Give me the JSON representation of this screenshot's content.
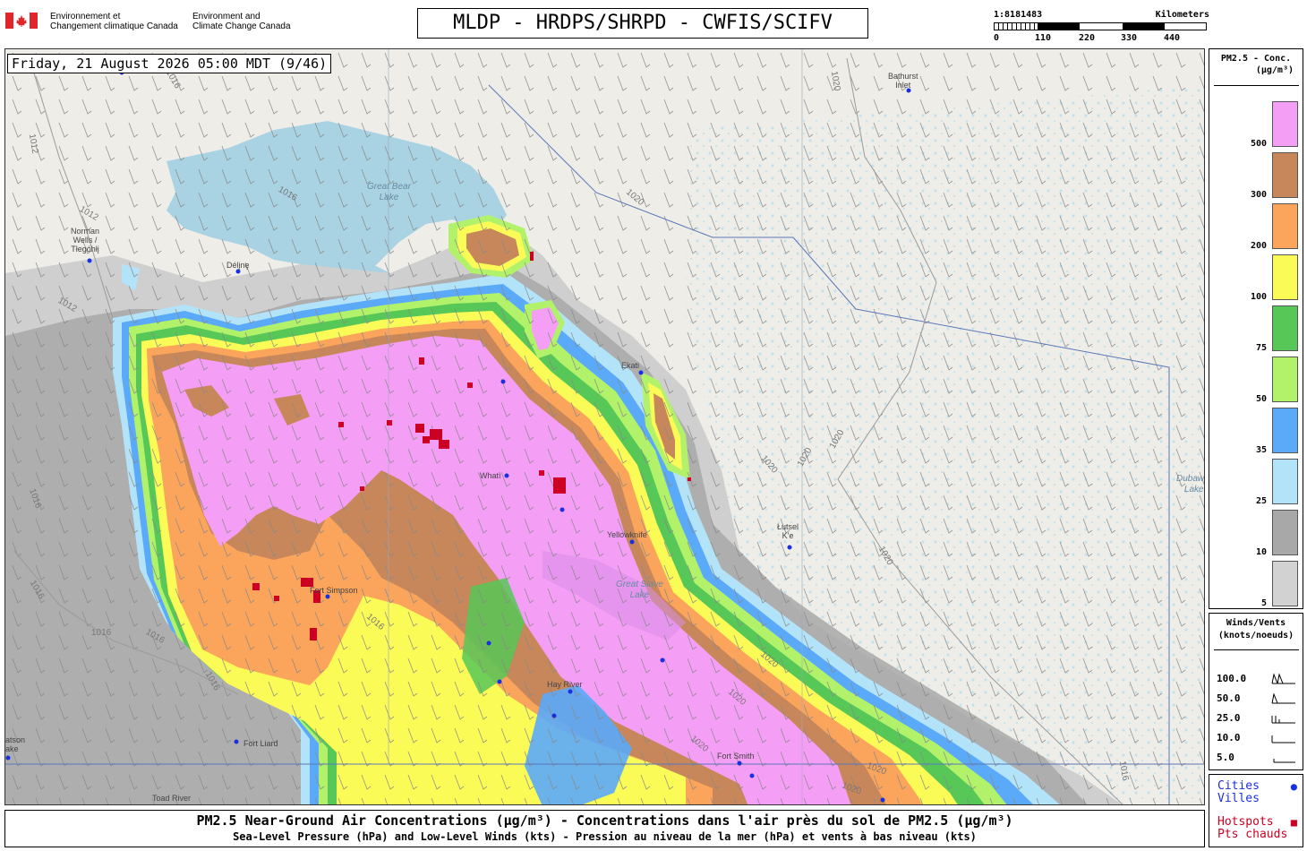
{
  "header": {
    "gov_fr": [
      "Environnement et",
      "Changement climatique Canada"
    ],
    "gov_en": [
      "Environment and",
      "Climate Change Canada"
    ],
    "title": "MLDP - HRDPS/SHRPD - CWFIS/SCIFV",
    "scale_ratio": "1:8181483",
    "scale_unit": "Kilometers",
    "scale_ticks": [
      "0",
      "110",
      "220",
      "330",
      "440"
    ]
  },
  "map": {
    "datestamp": "Friday, 21 August 2026 05:00 MDT (9/46)",
    "places": {
      "norman_wells": [
        "Norman",
        "Wells /",
        "Tłegóhłį"
      ],
      "deline": "Délįnę",
      "whati": "Whatì",
      "yellowknife": "Yellowknife",
      "hay_river": "Hay River",
      "fort_smith": "Fort Smith",
      "fort_liard": "Fort Liard",
      "toad_river": "Toad River",
      "lutsel_ke": [
        "Łutsel",
        "K'e"
      ],
      "bathurst_inlet": [
        "Bathurst",
        "Inlet"
      ],
      "fort_simpson": "Fort Simpson",
      "watson_lake": [
        "atson",
        "ake"
      ],
      "ekati": "Ekati"
    },
    "lakes": {
      "great_bear": [
        "Great Bear",
        "Lake"
      ],
      "great_slave": [
        "Great Slave",
        "Lake"
      ],
      "dubawnt": [
        "Dubawnt",
        "Lake"
      ]
    },
    "isobars": [
      "1012",
      "1016",
      "1020",
      "1016",
      "1012",
      "1012",
      "1016",
      "1016",
      "1016",
      "1016",
      "1016",
      "1016",
      "1020",
      "1020",
      "1020",
      "1020",
      "1020",
      "1020",
      "1020",
      "1020",
      "1020",
      "1016",
      "1020"
    ]
  },
  "legend": {
    "title": [
      "PM2.5 - Conc.",
      "(µg/m³)"
    ],
    "bins": [
      {
        "label": "500",
        "color": "#f59ef5"
      },
      {
        "label": "300",
        "color": "#c8875a"
      },
      {
        "label": "200",
        "color": "#fba45b"
      },
      {
        "label": "100",
        "color": "#fbfb57"
      },
      {
        "label": "75",
        "color": "#57c757"
      },
      {
        "label": "50",
        "color": "#b1f26a"
      },
      {
        "label": "35",
        "color": "#5aaaf9"
      },
      {
        "label": "25",
        "color": "#b3e3f9"
      },
      {
        "label": "10",
        "color": "#a8a8a8"
      },
      {
        "label": "5",
        "color": "#d2d2d2"
      }
    ]
  },
  "winds": {
    "title": [
      "Winds/Vents",
      "(knots/noeuds)"
    ],
    "speeds": [
      "100.0",
      "50.0",
      "25.0",
      "10.0",
      "5.0"
    ]
  },
  "key": {
    "cities": [
      "Cities",
      "Villes"
    ],
    "hotspots": [
      "Hotspots",
      "Pts chauds"
    ],
    "city_color": "#1a2fe0",
    "hotspot_color": "#cc0022"
  },
  "footer": {
    "line1": "PM2.5 Near-Ground Air Concentrations (µg/m³) - Concentrations dans l'air près du sol de PM2.5 (µg/m³)",
    "line2": "Sea-Level Pressure (hPa) and Low-Level Winds (kts) - Pression au niveau de la mer (hPa) et vents à bas niveau (kts)"
  }
}
